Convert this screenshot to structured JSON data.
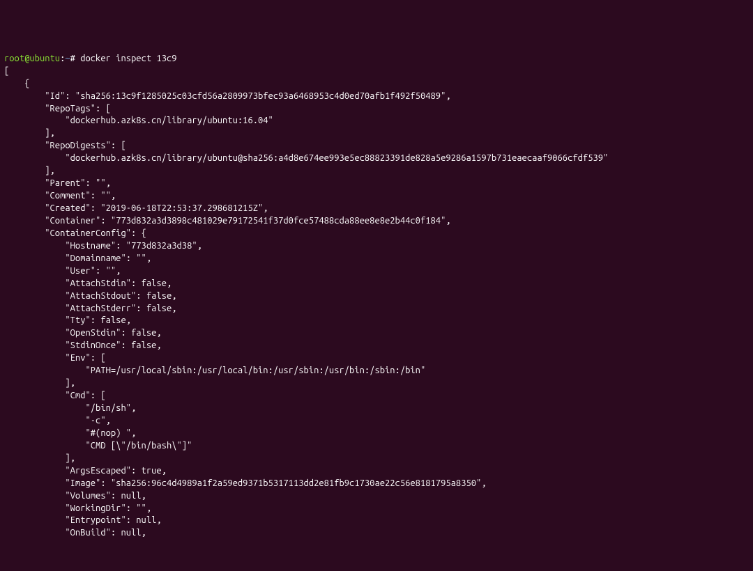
{
  "prompt": {
    "user_host": "root@ubuntu",
    "separator1": ":",
    "path": "~",
    "separator2": "# ",
    "command": "docker inspect 13c9"
  },
  "lines": {
    "l0": "[",
    "l1": "    {",
    "l2": "        \"Id\": \"sha256:13c9f1285025c03cfd56a2809973bfec93a6468953c4d0ed70afb1f492f50489\",",
    "l3": "        \"RepoTags\": [",
    "l4": "            \"dockerhub.azk8s.cn/library/ubuntu:16.04\"",
    "l5": "        ],",
    "l6": "        \"RepoDigests\": [",
    "l7": "            \"dockerhub.azk8s.cn/library/ubuntu@sha256:a4d8e674ee993e5ec88823391de828a5e9286a1597b731eaecaaf9066cfdf539\"",
    "l8": "        ],",
    "l9": "        \"Parent\": \"\",",
    "l10": "        \"Comment\": \"\",",
    "l11": "        \"Created\": \"2019-06-18T22:53:37.298681215Z\",",
    "l12": "        \"Container\": \"773d832a3d3898c481029e79172541f37d0fce57488cda88ee8e8e2b44c0f184\",",
    "l13": "        \"ContainerConfig\": {",
    "l14": "            \"Hostname\": \"773d832a3d38\",",
    "l15": "            \"Domainname\": \"\",",
    "l16": "            \"User\": \"\",",
    "l17": "            \"AttachStdin\": false,",
    "l18": "            \"AttachStdout\": false,",
    "l19": "            \"AttachStderr\": false,",
    "l20": "            \"Tty\": false,",
    "l21": "            \"OpenStdin\": false,",
    "l22": "            \"StdinOnce\": false,",
    "l23": "            \"Env\": [",
    "l24": "                \"PATH=/usr/local/sbin:/usr/local/bin:/usr/sbin:/usr/bin:/sbin:/bin\"",
    "l25": "            ],",
    "l26": "            \"Cmd\": [",
    "l27": "                \"/bin/sh\",",
    "l28": "                \"-c\",",
    "l29": "                \"#(nop) \",",
    "l30": "                \"CMD [\\\"/bin/bash\\\"]\"",
    "l31": "            ],",
    "l32": "            \"ArgsEscaped\": true,",
    "l33": "            \"Image\": \"sha256:96c4d4989a1f2a59ed9371b5317113dd2e81fb9c1730ae22c56e8181795a8350\",",
    "l34": "            \"Volumes\": null,",
    "l35": "            \"WorkingDir\": \"\",",
    "l36": "            \"Entrypoint\": null,",
    "l37": "            \"OnBuild\": null,"
  }
}
